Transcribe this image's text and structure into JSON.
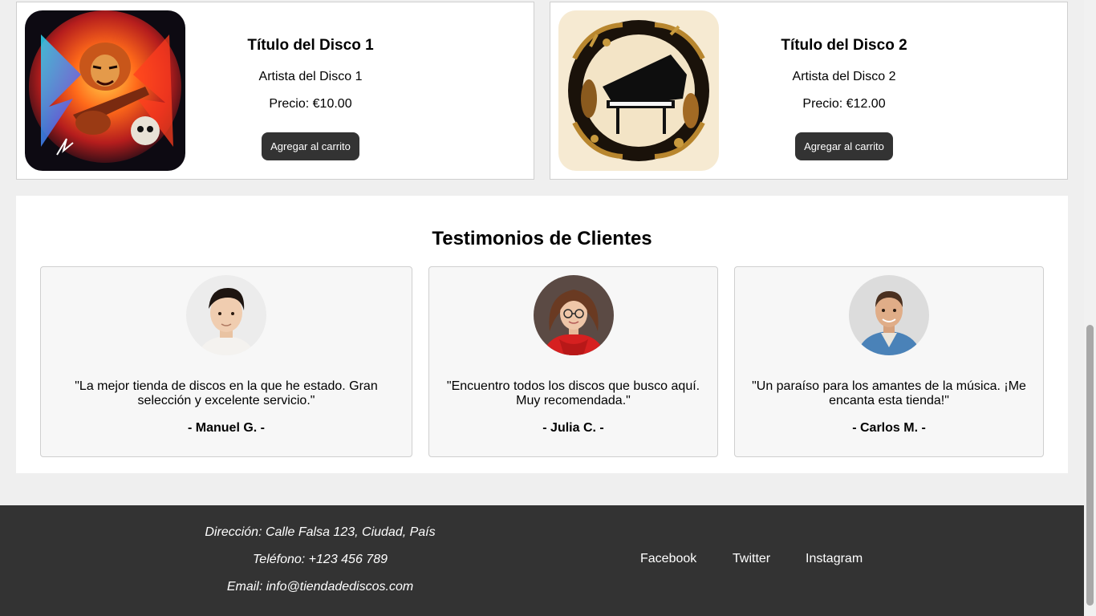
{
  "products": [
    {
      "title": "Título del Disco 1",
      "artist": "Artista del Disco 1",
      "price": "Precio: €10.00",
      "cart_label": "Agregar al carrito",
      "cover": "rock-lion-guitar-cover"
    },
    {
      "title": "Título del Disco 2",
      "artist": "Artista del Disco 2",
      "price": "Precio: €12.00",
      "cart_label": "Agregar al carrito",
      "cover": "piano-instruments-cover"
    }
  ],
  "testimonials": {
    "heading": "Testimonios de Clientes",
    "items": [
      {
        "quote": "\"La mejor tienda de discos en la que he estado. Gran selección y excelente servicio.\"",
        "author": "- Manuel G. -"
      },
      {
        "quote": "\"Encuentro todos los discos que busco aquí. Muy recomendada.\"",
        "author": "- Julia C. -"
      },
      {
        "quote": "\"Un paraíso para los amantes de la música. ¡Me encanta esta tienda!\"",
        "author": "- Carlos M. -"
      }
    ]
  },
  "footer": {
    "address": "Dirección: Calle Falsa 123, Ciudad, País",
    "phone": "Teléfono: +123 456 789",
    "email": "Email: info@tiendadediscos.com",
    "social": [
      "Facebook",
      "Twitter",
      "Instagram"
    ]
  },
  "colors": {
    "button_bg": "#333333",
    "footer_bg": "#333333",
    "page_bg": "#efefef"
  }
}
